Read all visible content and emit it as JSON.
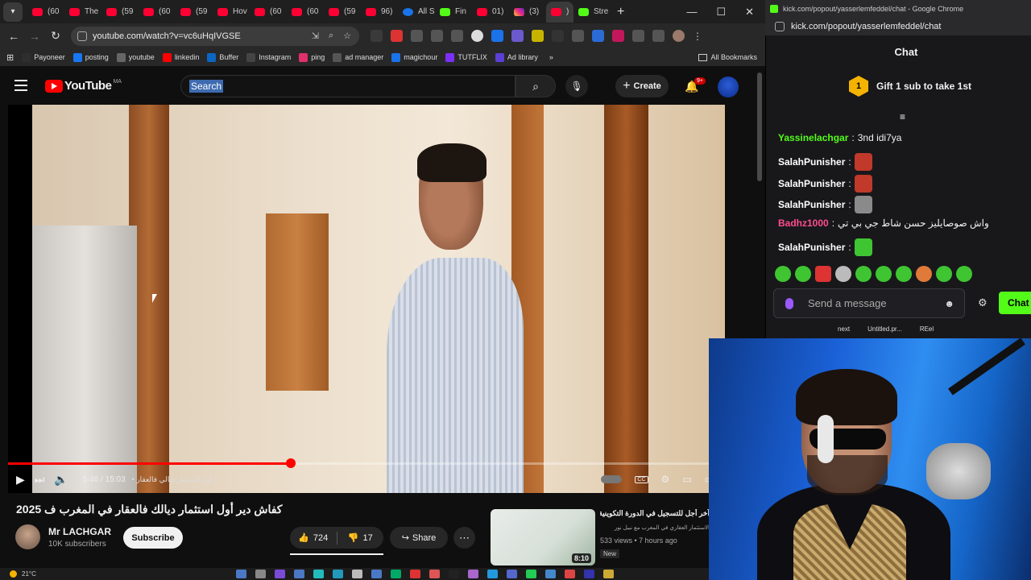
{
  "browser": {
    "tabs": [
      {
        "label": "(60",
        "favicon": "youtube"
      },
      {
        "label": "The",
        "favicon": "youtube"
      },
      {
        "label": "(59",
        "favicon": "youtube"
      },
      {
        "label": "(60",
        "favicon": "youtube"
      },
      {
        "label": "(59",
        "favicon": "youtube"
      },
      {
        "label": "Hov",
        "favicon": "youtube"
      },
      {
        "label": "(60",
        "favicon": "youtube"
      },
      {
        "label": "(60",
        "favicon": "youtube"
      },
      {
        "label": "(59",
        "favicon": "youtube"
      },
      {
        "label": "96)",
        "favicon": "youtube"
      },
      {
        "label": "All S",
        "favicon": "blue"
      },
      {
        "label": "Fin",
        "favicon": "green"
      },
      {
        "label": "01)",
        "favicon": "youtube"
      },
      {
        "label": "(3)",
        "favicon": "instagram"
      },
      {
        "label": ")",
        "favicon": "youtube"
      },
      {
        "label": "Stre",
        "favicon": "kick"
      }
    ],
    "url": "youtube.com/watch?v=vc6uHqIVGSE",
    "bookmarks": [
      "Payoneer",
      "posting",
      "youtube",
      "linkedin",
      "Buffer",
      "Instagram",
      "ping",
      "ad manager",
      "magichour",
      "TUTFLIX",
      "Ad library"
    ],
    "all_bookmarks": "All Bookmarks"
  },
  "youtube": {
    "logo": "YouTube",
    "country": "MA",
    "search_text": "Search",
    "create_label": "Create",
    "notifications_badge": "9+",
    "video": {
      "time_current": "5:46",
      "time_total": "15:03",
      "chapter": "أول استثمار ديالي فالعقار",
      "progress": 0.404,
      "buffered": 0.49,
      "title": "كفاش دير أول استثمار ديالك فالعقار في المغرب ف 2025"
    },
    "channel": {
      "name": "Mr LACHGAR",
      "subscribers": "10K subscribers",
      "subscribe_label": "Subscribe"
    },
    "actions": {
      "likes": "724",
      "dislikes": "17",
      "share_label": "Share"
    },
    "recommendation": {
      "title": "آخر أجل للتسجيل في الدورة التكوينية التاسعة",
      "channel": "الاستثمار العقاري في المغرب مع نبيل نور",
      "meta": "533 views • 7 hours ago",
      "badge": "New",
      "duration": "8:10"
    }
  },
  "taskbar": {
    "weather": "21°C"
  },
  "kick": {
    "window_title": "kick.com/popout/yasserlemfeddel/chat - Google Chrome",
    "url": "kick.com/popout/yasserlemfeddel/chat",
    "chat_title": "Chat",
    "gift_label": "Gift 1 sub to take 1st",
    "gift_rank": "1",
    "messages": [
      {
        "user": "Yassinelachgar",
        "color": "#53fc18",
        "text": "3nd idi7ya"
      },
      {
        "user": "SalahPunisher",
        "color": "#ffffff",
        "text": ""
      },
      {
        "user": "SalahPunisher",
        "color": "#ffffff",
        "text": ""
      },
      {
        "user": "SalahPunisher",
        "color": "#ffffff",
        "text": ""
      },
      {
        "user": "Badhz1000",
        "color": "#ff4d8d",
        "text": "واش صوصايليز حسن شاط جي بي تي"
      },
      {
        "user": "SalahPunisher",
        "color": "#ffffff",
        "text": ""
      }
    ],
    "input_placeholder": "Send a message",
    "send_label": "Chat",
    "desktop_icons": [
      "next",
      "Untitled.pr...",
      "REel"
    ]
  },
  "colors": {
    "youtube_red": "#ff0000",
    "kick_green": "#53fc18",
    "background": "#0f0f0f"
  }
}
